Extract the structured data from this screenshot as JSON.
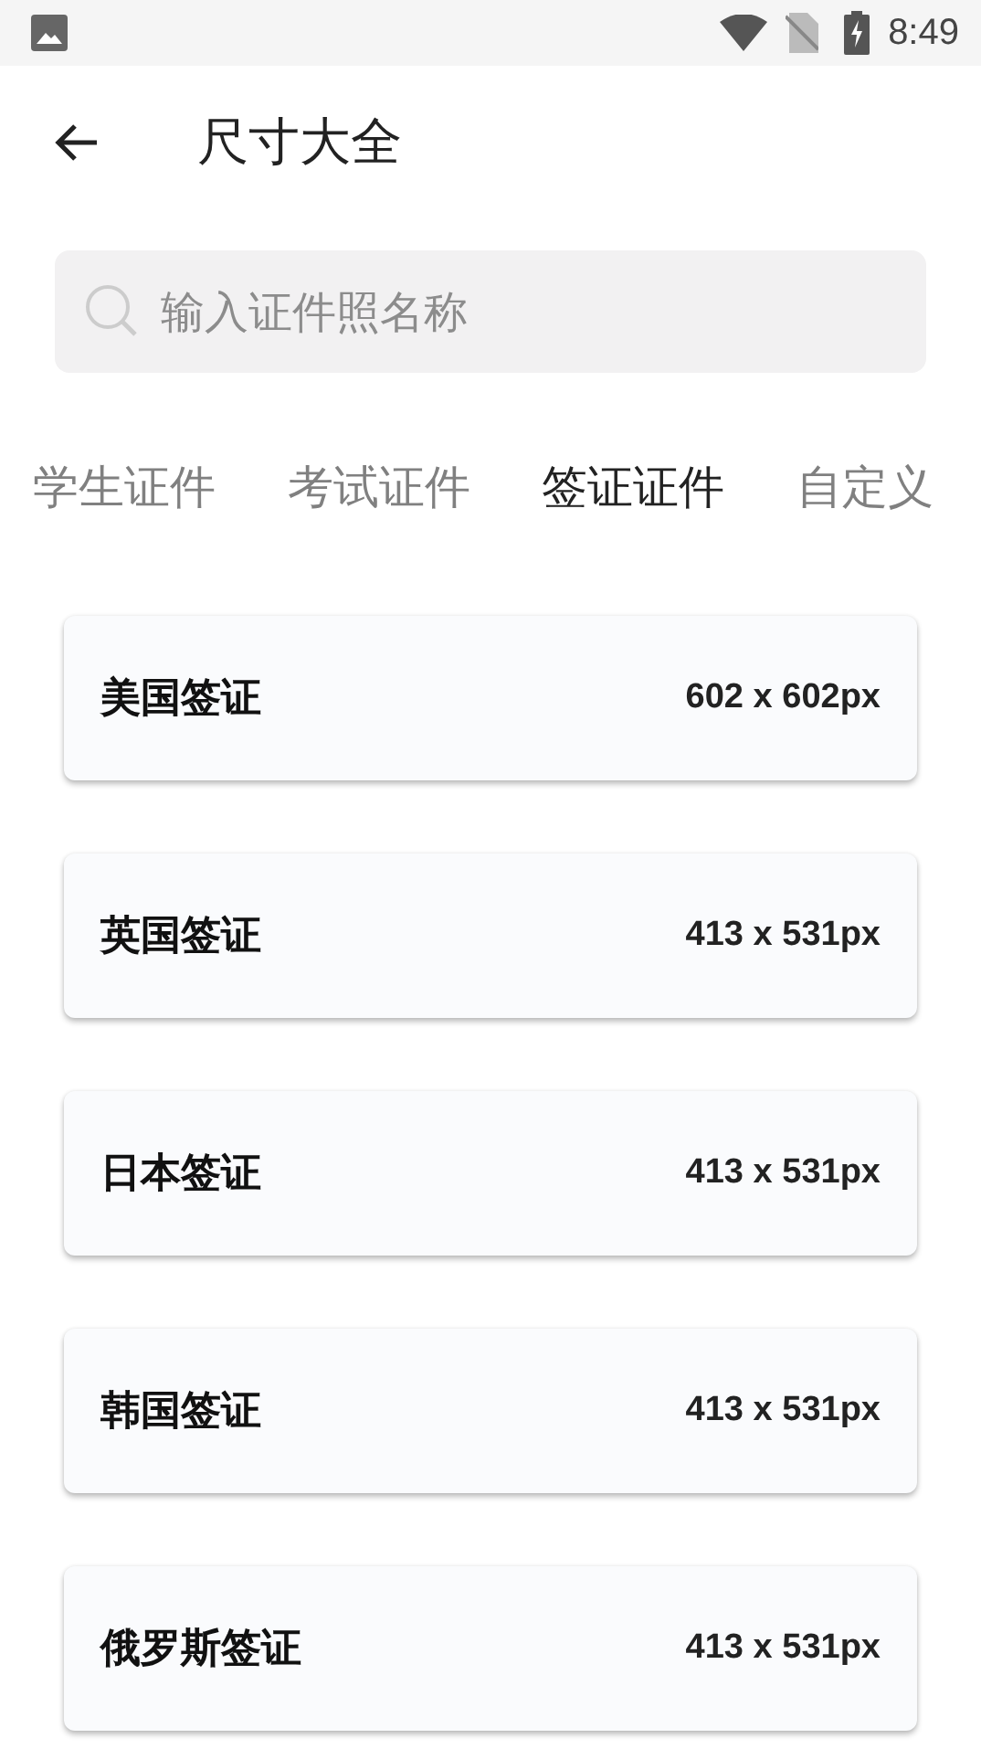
{
  "status_bar": {
    "time": "8:49"
  },
  "app_bar": {
    "title": "尺寸大全"
  },
  "search": {
    "placeholder": "输入证件照名称"
  },
  "tabs": [
    {
      "label": "学生证件",
      "selected": false
    },
    {
      "label": "考试证件",
      "selected": false
    },
    {
      "label": "签证证件",
      "selected": true
    },
    {
      "label": "自定义",
      "selected": false
    }
  ],
  "items": [
    {
      "name": "美国签证",
      "size": "602 x 602px"
    },
    {
      "name": "英国签证",
      "size": "413 x 531px"
    },
    {
      "name": "日本签证",
      "size": "413 x 531px"
    },
    {
      "name": "韩国签证",
      "size": "413 x 531px"
    },
    {
      "name": "俄罗斯签证",
      "size": "413 x 531px"
    }
  ]
}
